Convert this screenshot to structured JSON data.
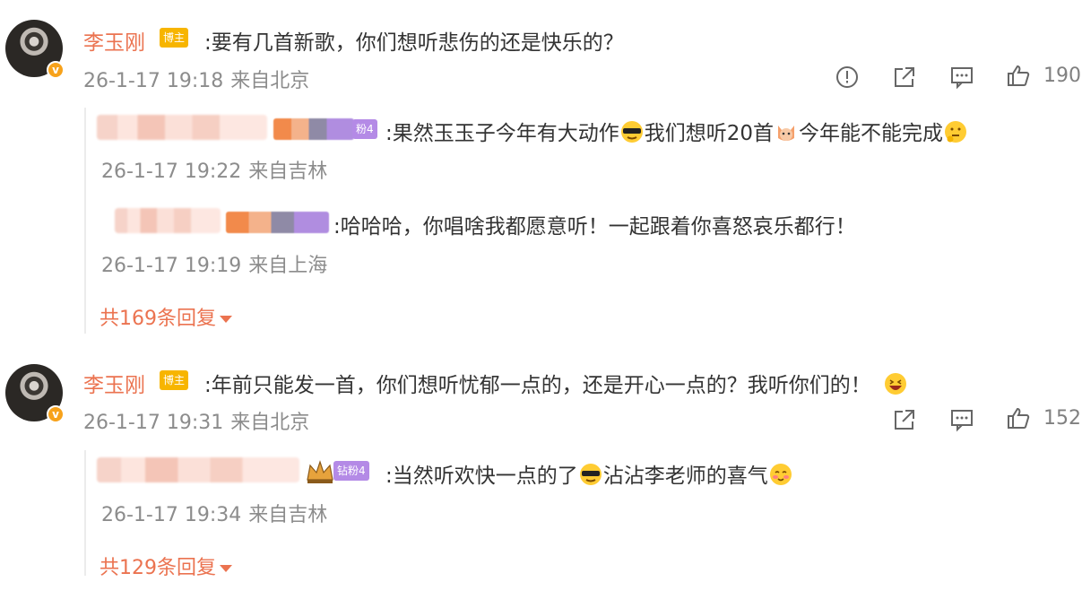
{
  "comments": [
    {
      "author": "李玉刚",
      "author_badge": "博主",
      "avatar_badge": "v",
      "text": ":要有几首新歌，你们想听悲伤的还是快乐的？",
      "time": "26-1-17 19:18",
      "location": "来自北京",
      "likes": "190",
      "replies": [
        {
          "fan_level": "粉4",
          "text_a": ":果然玉玉子今年有大动作",
          "emoji_a": "cool-sunglasses-emoji",
          "text_b": "我们想听20首",
          "emoji_b": "cat-emoji",
          "text_c": "今年能不能完成",
          "emoji_c": "thinking-emoji",
          "time": "26-1-17 19:22",
          "location": "来自吉林"
        },
        {
          "text": ":哈哈哈，你唱啥我都愿意听！一起跟着你喜怒哀乐都行！",
          "time": "26-1-17 19:19",
          "location": "来自上海"
        }
      ],
      "more_replies": "共169条回复"
    },
    {
      "author": "李玉刚",
      "author_badge": "博主",
      "avatar_badge": "v",
      "text": ":年前只能发一首，你们想听忧郁一点的，还是开心一点的？我听你们的！",
      "emoji": "laughing-emoji",
      "time": "26-1-17 19:31",
      "location": "来自北京",
      "likes": "152",
      "replies": [
        {
          "fan_level": "钻粉4",
          "text_a": ":当然听欢快一点的了",
          "emoji_a": "cool-sunglasses-emoji",
          "text_b": "沾沾李老师的喜气",
          "emoji_b": "blush-emoji",
          "time": "26-1-17 19:34",
          "location": "来自吉林"
        }
      ],
      "more_replies": "共129条回复"
    }
  ],
  "colors": {
    "accent": "#eb7350",
    "badge": "#f7b500",
    "meta": "#8c8c8c",
    "fan": "#b48ae6"
  },
  "icons": [
    "report-icon",
    "share-icon",
    "comment-icon",
    "like-icon"
  ]
}
